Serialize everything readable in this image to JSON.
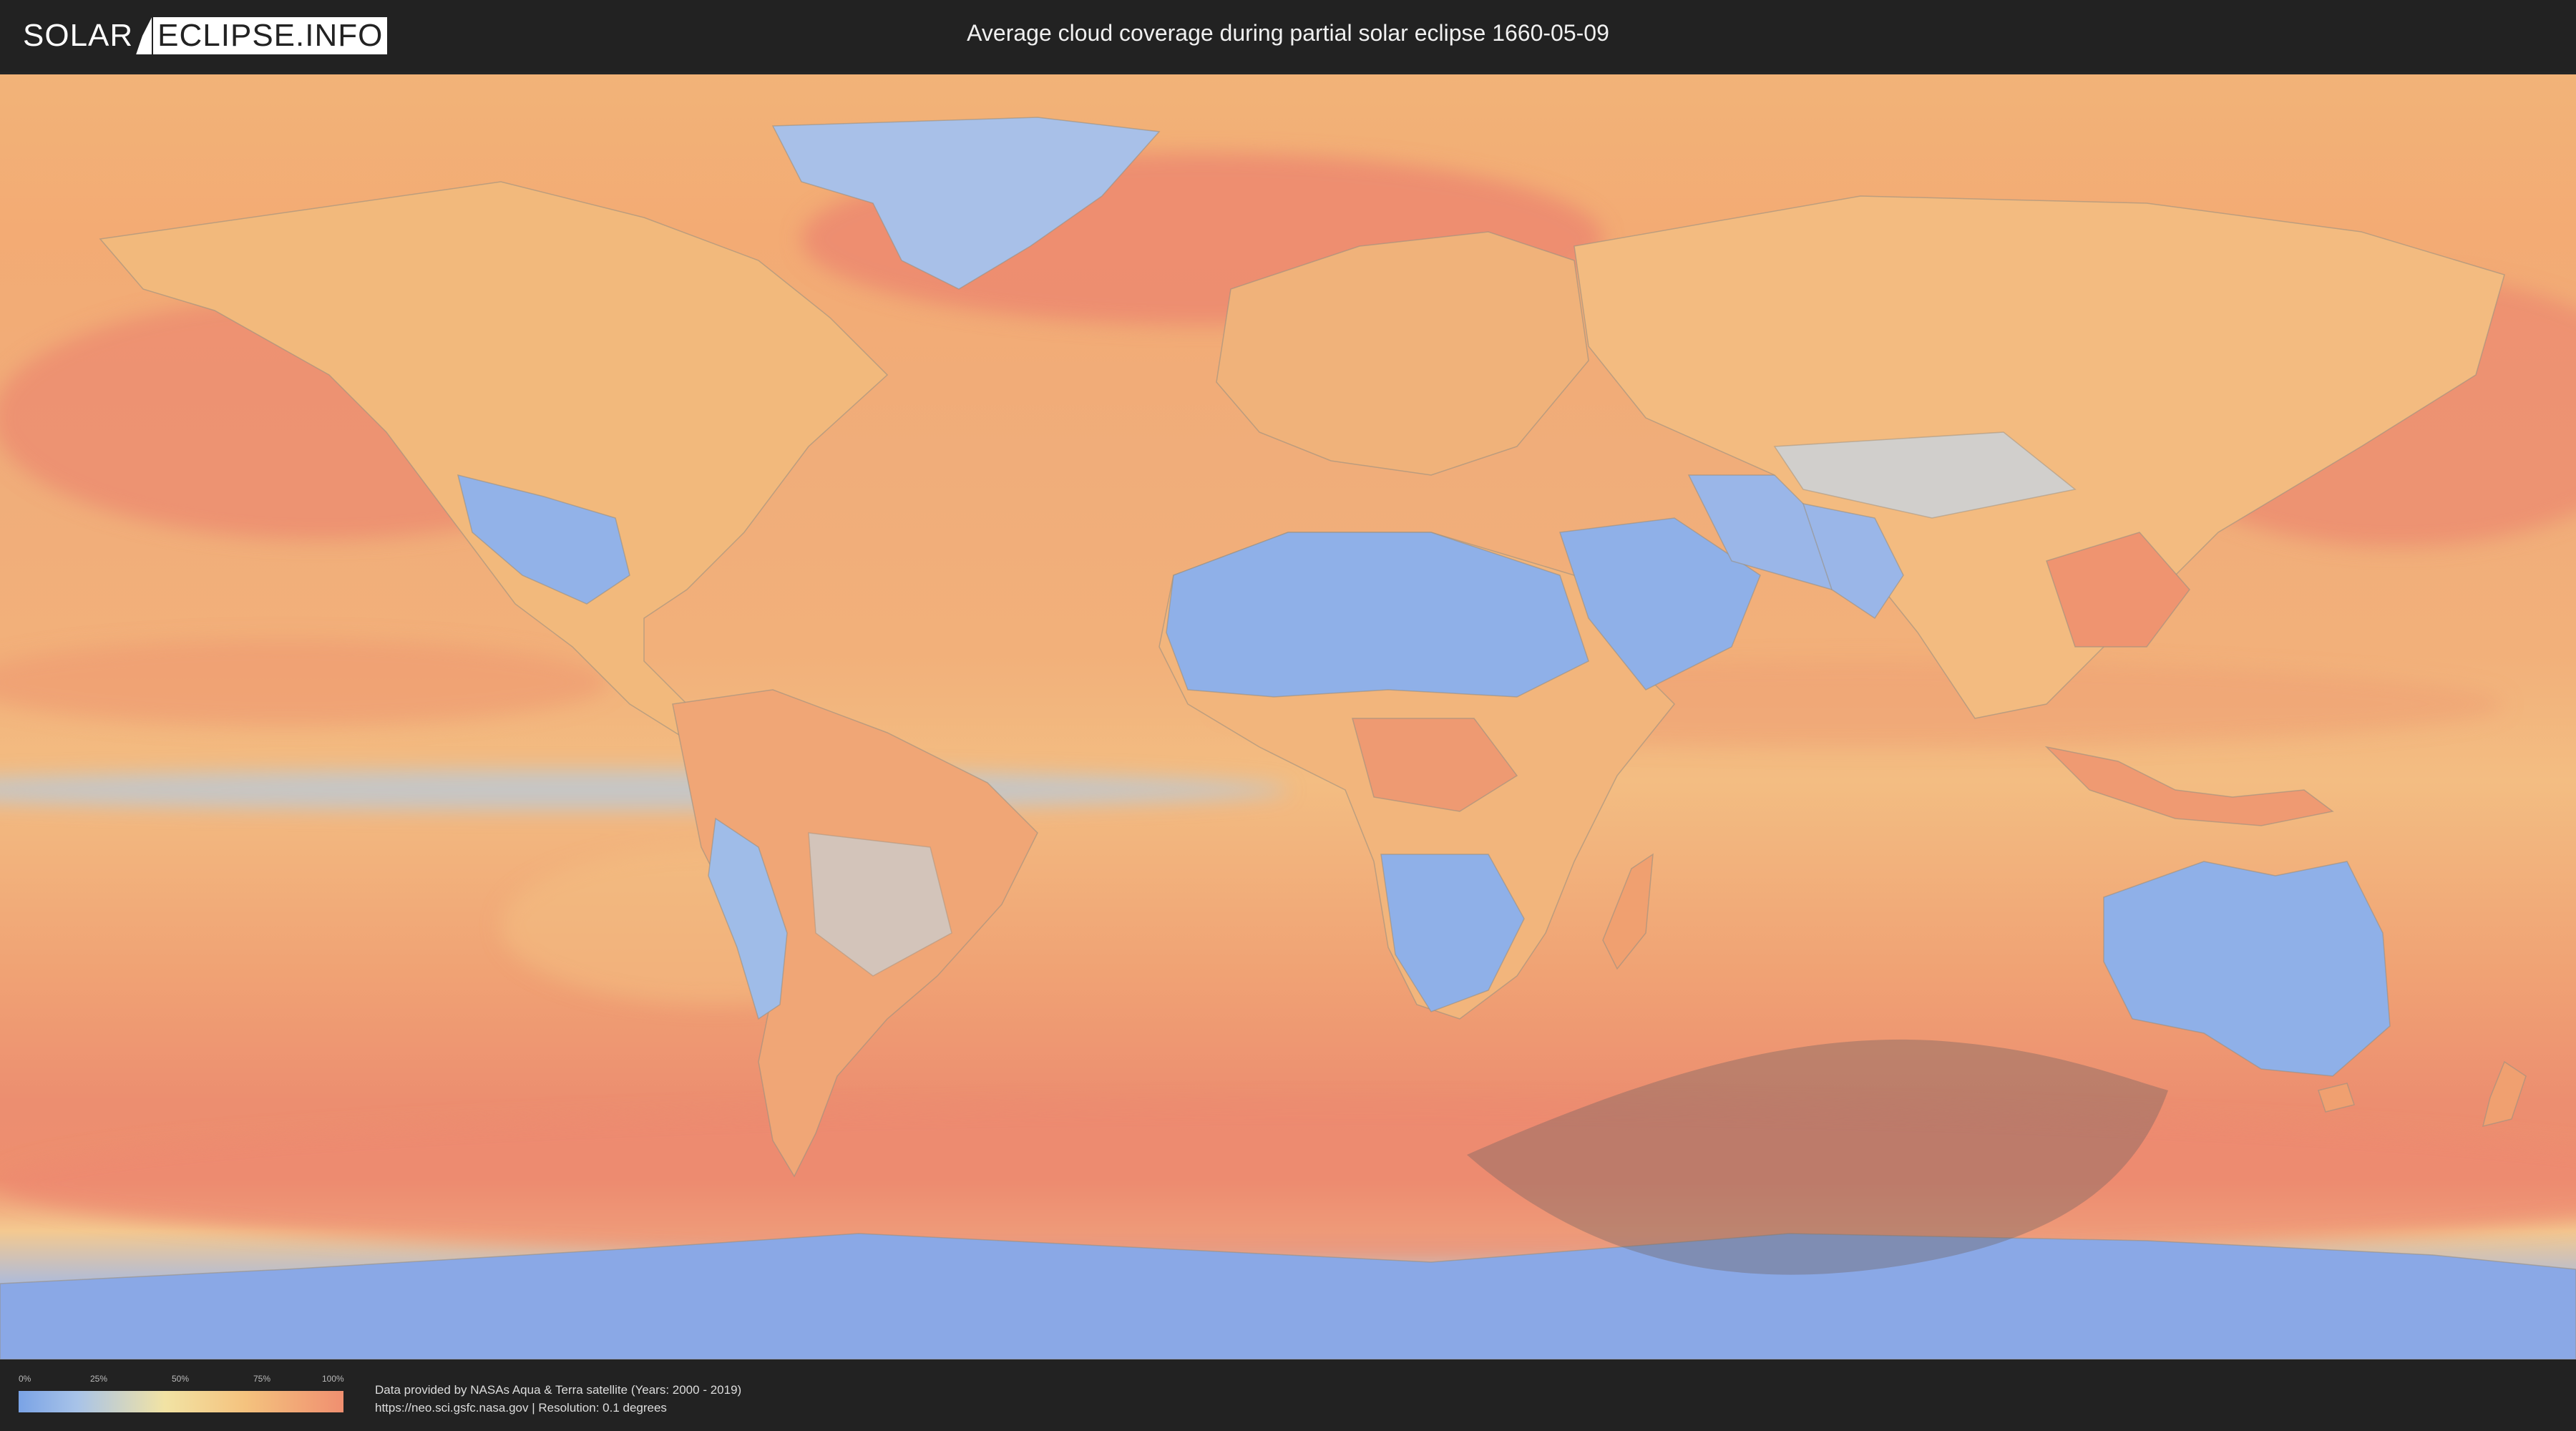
{
  "header": {
    "logo_part1": "SOLAR",
    "logo_part2": "ECLIPSE.INFO",
    "title": "Average cloud coverage during partial solar eclipse 1660-05-09"
  },
  "map": {
    "type": "cloud-coverage-world-map",
    "eclipse_region_color": "#7a6a6a",
    "ocean_color_high_cloud": "#ef8a72",
    "desert_color_low_cloud": "#8fb0e8"
  },
  "legend": {
    "ticks": [
      "0%",
      "25%",
      "50%",
      "75%",
      "100%"
    ],
    "colors": [
      "#7aa3e6",
      "#f2e3a4",
      "#f08f70"
    ]
  },
  "footer": {
    "credit_line1": "Data provided by NASAs Aqua & Terra satellite (Years: 2000 - 2019)",
    "credit_line2": "https://neo.sci.gsfc.nasa.gov | Resolution: 0.1 degrees"
  }
}
